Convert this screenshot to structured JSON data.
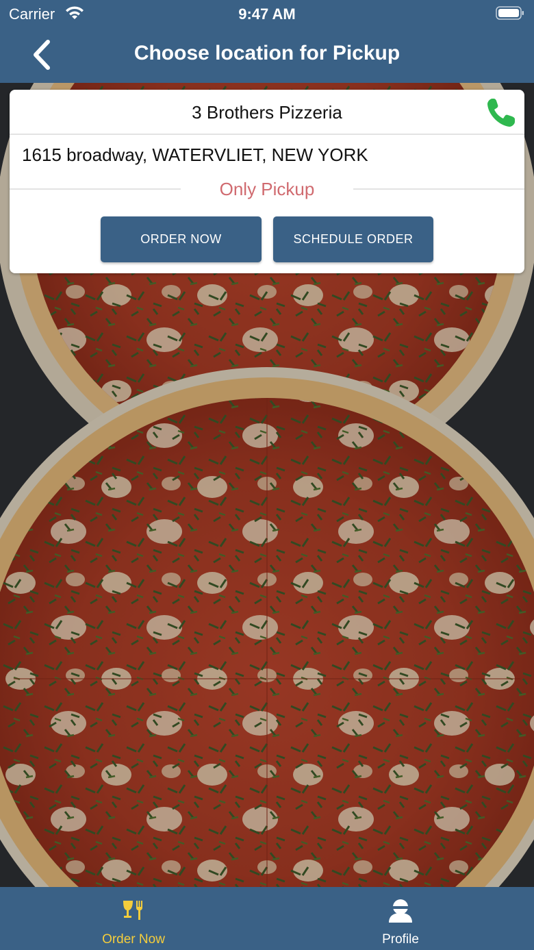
{
  "status_bar": {
    "carrier": "Carrier",
    "time": "9:47 AM"
  },
  "nav": {
    "title": "Choose location for Pickup",
    "back_icon": "chevron-left-icon"
  },
  "location": {
    "name": "3 Brothers Pizzeria",
    "address": "1615 broadway, WATERVLIET, NEW YORK",
    "pickup_note": "Only Pickup",
    "order_now_label": "ORDER NOW",
    "schedule_order_label": "SCHEDULE ORDER",
    "phone_icon": "phone-icon"
  },
  "tabs": [
    {
      "label": "Order Now",
      "icon": "food-icon",
      "active": true
    },
    {
      "label": "Profile",
      "icon": "profile-icon",
      "active": false
    }
  ],
  "colors": {
    "brand": "#3a6186",
    "active_tab": "#f4cd3c",
    "pickup_note": "#d06a6f",
    "phone": "#2fb84f"
  }
}
